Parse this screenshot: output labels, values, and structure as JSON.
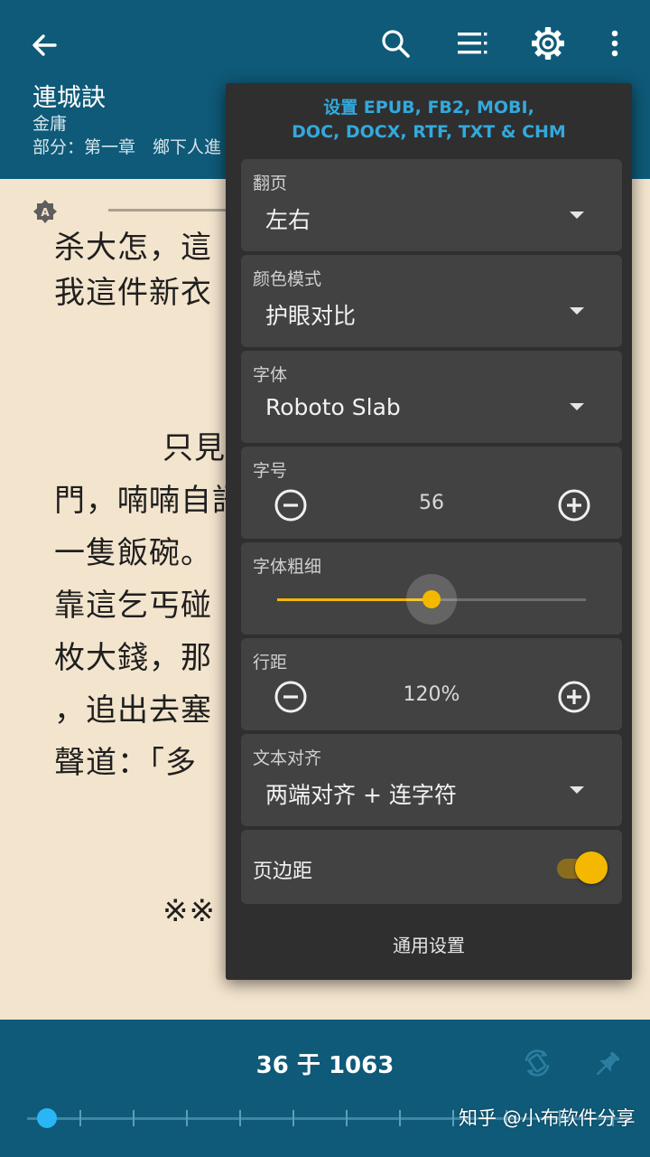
{
  "app": {
    "book_title": "連城訣",
    "author": "金庸",
    "chapter": "部分：第一章　鄉下人進"
  },
  "reader": {
    "lines": [
      "杀大怎，這",
      "我這件新衣",
      "只見",
      "門，喃喃自語",
      "一隻飯碗。",
      "靠這乞丐碰",
      "枚大錢，那",
      "，追出去塞",
      "聲道：「多",
      "※※"
    ]
  },
  "settings": {
    "header": "设置 EPUB, FB2, MOBI,\nDOC, DOCX, RTF, TXT & CHM",
    "page_turn": {
      "label": "翻页",
      "value": "左右"
    },
    "color_mode": {
      "label": "颜色模式",
      "value": "护眼对比"
    },
    "font": {
      "label": "字体",
      "value": "Roboto Slab"
    },
    "font_size": {
      "label": "字号",
      "value": "56"
    },
    "font_weight": {
      "label": "字体粗细",
      "level": 0.5
    },
    "line_spacing": {
      "label": "行距",
      "value": "120%"
    },
    "text_align": {
      "label": "文本对齐",
      "value": "两端对齐 + 连字符"
    },
    "margins": {
      "label": "页边距",
      "enabled": true
    },
    "general_settings": "通用设置"
  },
  "footer": {
    "page_indicator": "36 于 1063",
    "progress": 0.034,
    "watermark_text": "知乎 @小布软件分享"
  },
  "colors": {
    "appbar": "#0e5a78",
    "accent": "#f5b800",
    "header_blue": "#33a9dc",
    "paper": "#f3e4cd"
  }
}
